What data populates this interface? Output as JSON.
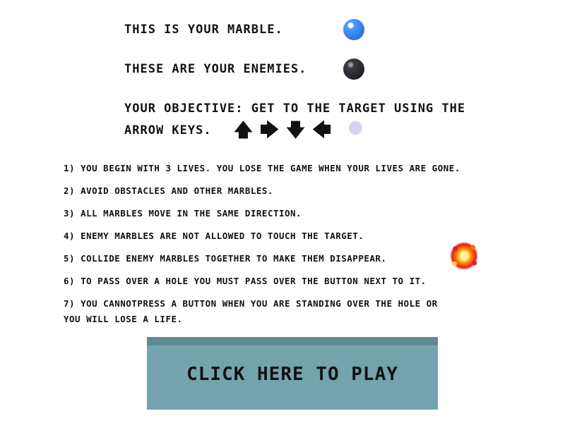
{
  "intro": {
    "marble_text": "THIS IS YOUR MARBLE.",
    "enemies_text": "THESE ARE YOUR ENEMIES.",
    "objective_line1": "YOUR OBJECTIVE: GET TO THE TARGET USING THE",
    "objective_line2": "ARROW KEYS."
  },
  "arrow_keys": [
    "🡅",
    "🡆",
    "🡇",
    "🡄"
  ],
  "icons": {
    "player_marble": "blue-marble-icon",
    "enemy_marble": "dark-marble-icon",
    "target": "target-circle-icon",
    "explosion": "explosion-icon"
  },
  "colors": {
    "player_marble": "#2f7bf0",
    "enemy_marble": "#2a2a30",
    "target": "#d9cfee",
    "play_button": "#74a3ae",
    "play_button_top": "#5f8b93"
  },
  "rules": [
    "1) YOU BEGIN WITH 3 LIVES. YOU LOSE THE GAME WHEN YOUR LIVES ARE GONE.",
    "2) AVOID OBSTACLES AND OTHER MARBLES.",
    "3) ALL MARBLES MOVE IN THE SAME DIRECTION.",
    "4) ENEMY MARBLES ARE NOT ALLOWED TO TOUCH THE TARGET.",
    "5) COLLIDE ENEMY MARBLES TOGETHER TO MAKE THEM DISAPPEAR.",
    "6) TO PASS OVER A HOLE YOU MUST PASS OVER THE BUTTON NEXT TO IT.",
    "7) YOU CANNOTPRESS A BUTTON WHEN YOU ARE STANDING OVER THE HOLE OR",
    "YOU WILL LOSE A LIFE."
  ],
  "play_button": {
    "label": "CLICK HERE TO PLAY"
  }
}
